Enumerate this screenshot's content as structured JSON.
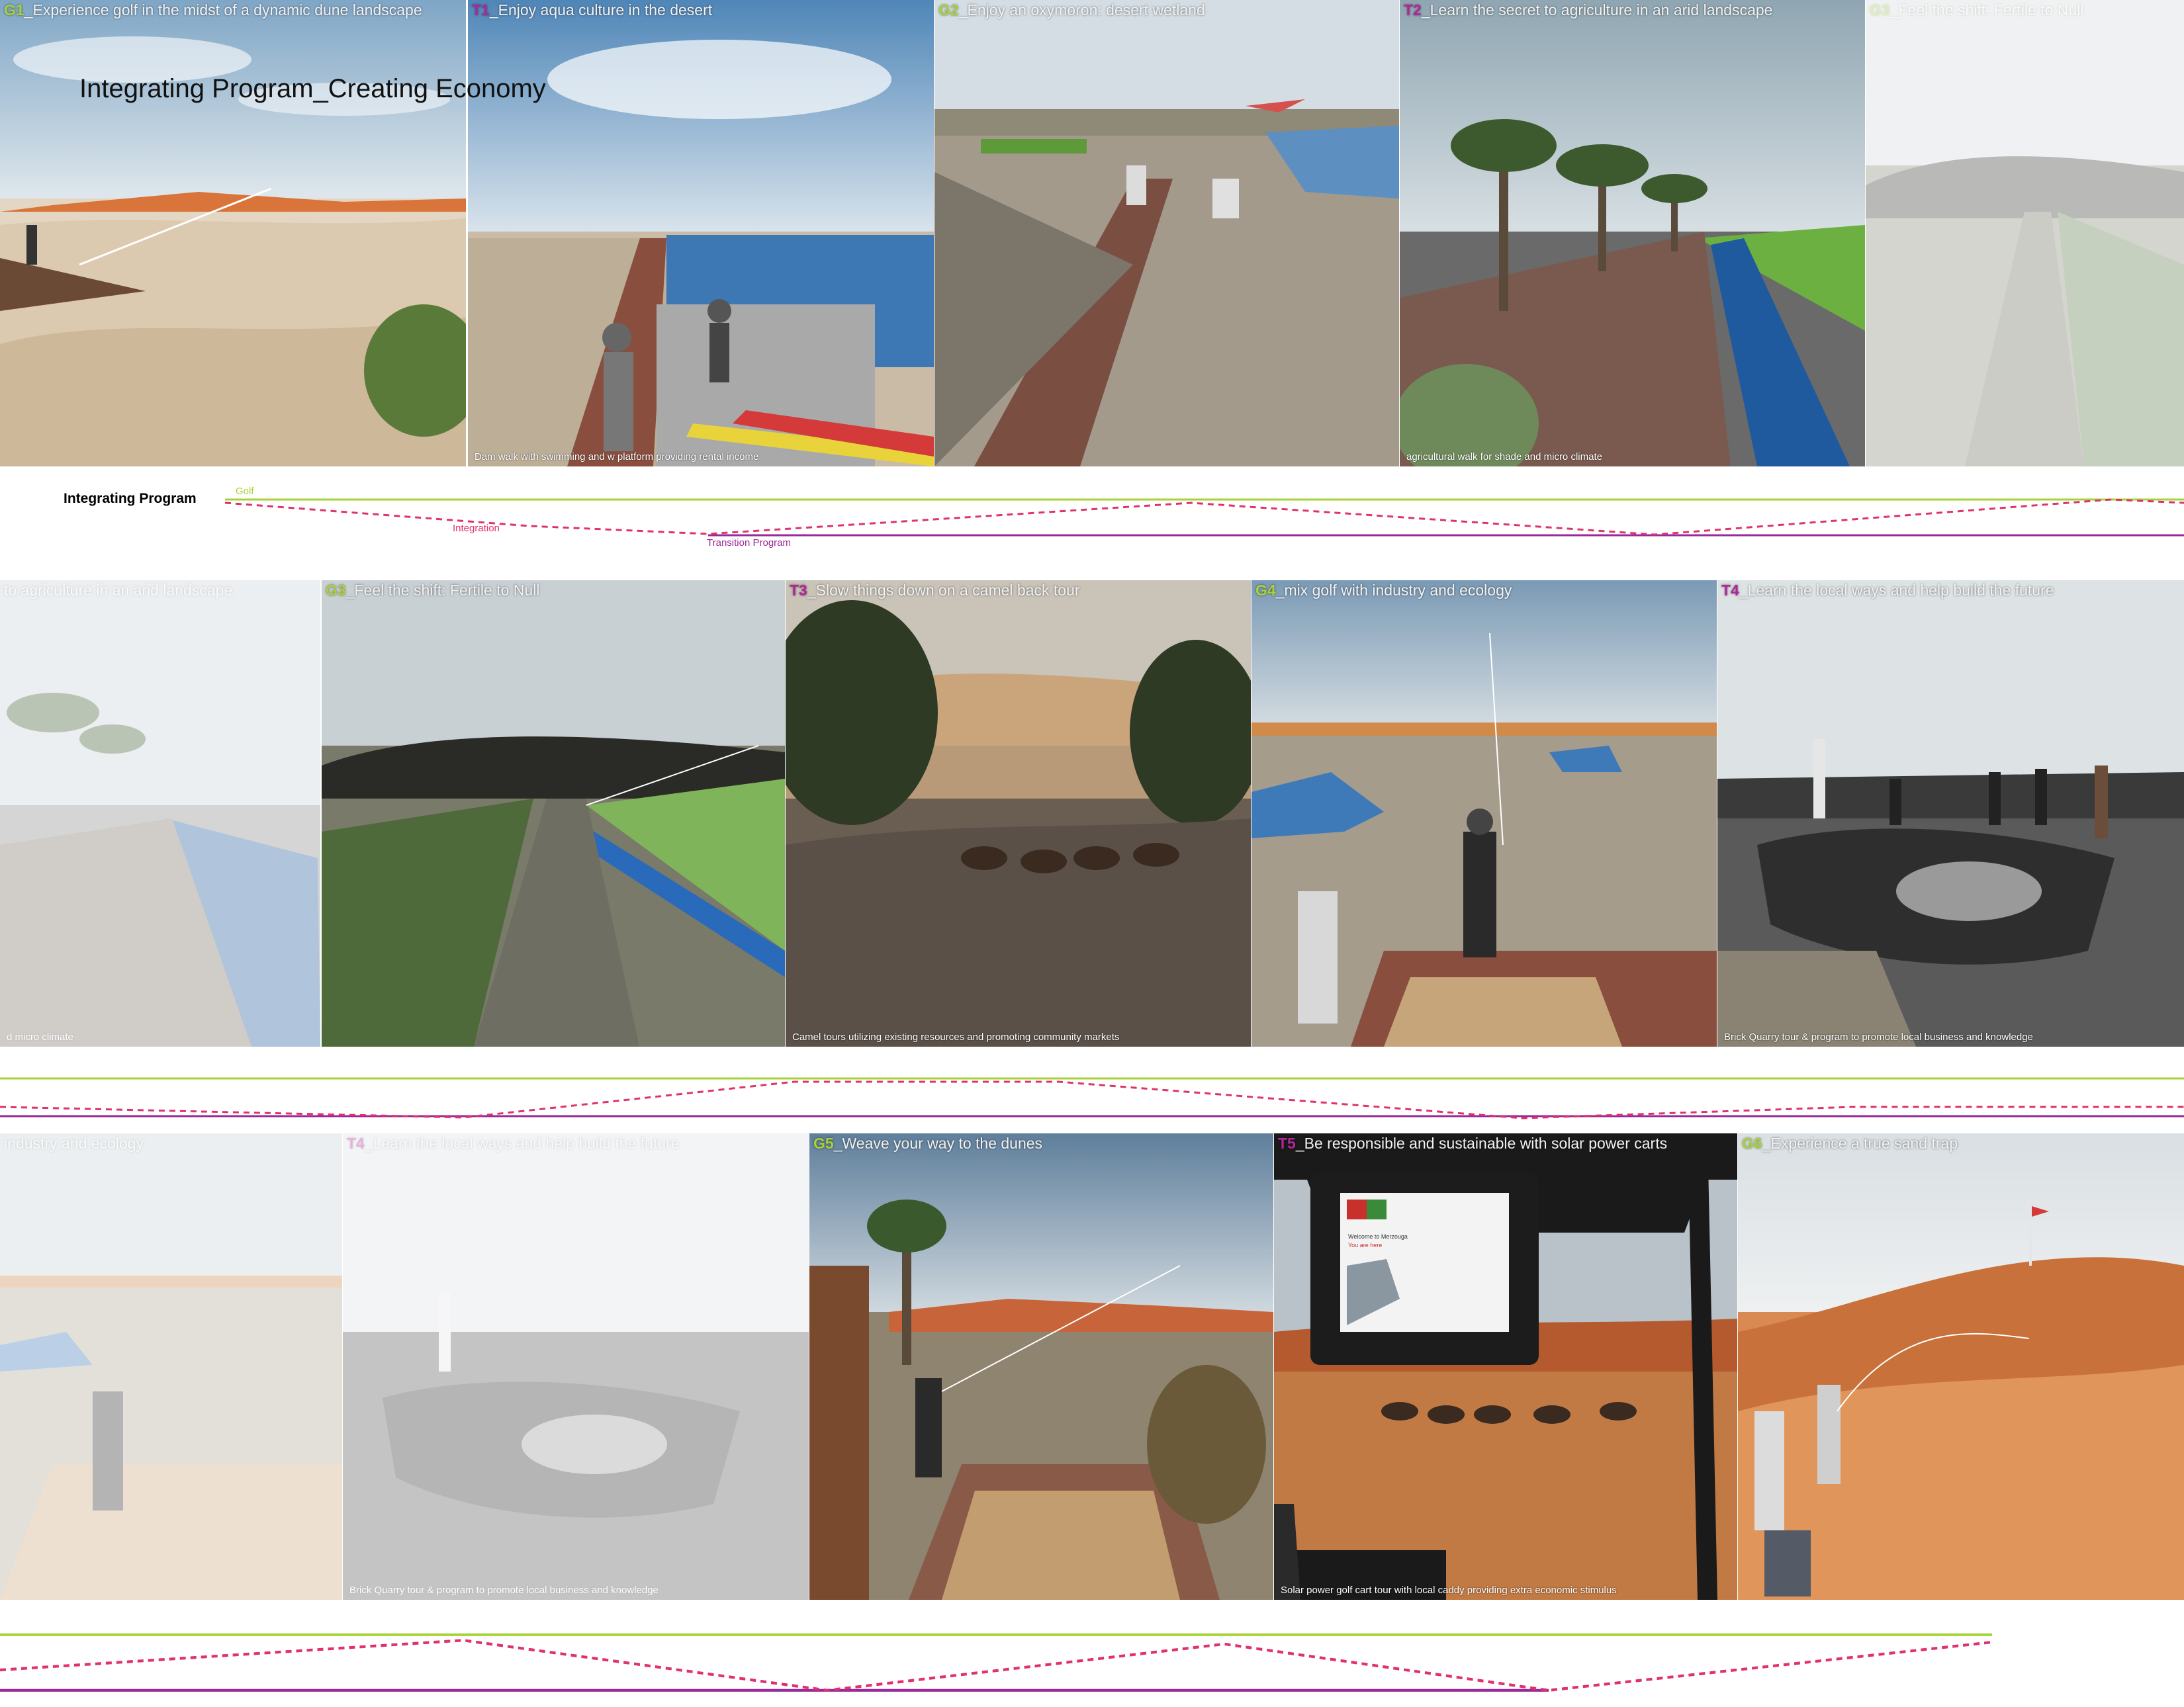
{
  "header": {
    "title": "Integrating Program_Creating Economy"
  },
  "colors": {
    "golf": "#a8d23a",
    "integration": "#e0316e",
    "transition": "#9a2a96"
  },
  "legend": {
    "row_label": "Integrating Program",
    "golf": "Golf",
    "integration": "Integration",
    "transition": "Transition Program"
  },
  "rows": [
    {
      "panels": [
        {
          "code": "G1",
          "text": "_Experience golf in the midst of a dynamic dune landscape",
          "caption": ""
        },
        {
          "code": "T1",
          "text": "_Enjoy aqua culture in the desert",
          "caption": "Dam walk with swimming and w platform providing rental income"
        },
        {
          "code": "G2",
          "text": "_Enjoy an oxymoron: desert wetland",
          "caption": ""
        },
        {
          "code": "T2",
          "text": "_Learn the secret to agriculture in an arid landscape",
          "caption": "agricultural walk for shade and micro climate"
        },
        {
          "code": "G3",
          "text": "_Feel the shift: Fertile to Null",
          "caption": ""
        }
      ]
    },
    {
      "panels": [
        {
          "code": "",
          "text": "to agriculture in an arid landscape",
          "caption": "d micro climate"
        },
        {
          "code": "G3",
          "text": "_Feel the shift: Fertile to Null",
          "caption": ""
        },
        {
          "code": "T3",
          "text": "_Slow things down on a camel back tour",
          "caption": "Camel tours utilizing existing resources and promoting community markets"
        },
        {
          "code": "G4",
          "text": "_mix golf with industry and ecology",
          "caption": ""
        },
        {
          "code": "T4",
          "text": "_Learn the local ways and help build the future",
          "caption": "Brick Quarry tour & program to promote local business and knowledge"
        }
      ]
    },
    {
      "panels": [
        {
          "code": "",
          "text": "industry and ecology",
          "caption": ""
        },
        {
          "code": "T4",
          "text": "_Learn the local ways and help build the future",
          "caption": "Brick Quarry tour & program to promote local business and knowledge"
        },
        {
          "code": "G5",
          "text": "_Weave your way to the dunes",
          "caption": ""
        },
        {
          "code": "T5",
          "text": "_Be responsible and sustainable with solar power carts",
          "caption": "Solar power golf cart tour with local caddy providing extra economic stimulus"
        },
        {
          "code": "G6",
          "text": "_Experience a true sand trap",
          "caption": ""
        }
      ]
    }
  ],
  "cart_screen": {
    "line1": "Welcome to Merzouga",
    "line2": "You are here"
  }
}
